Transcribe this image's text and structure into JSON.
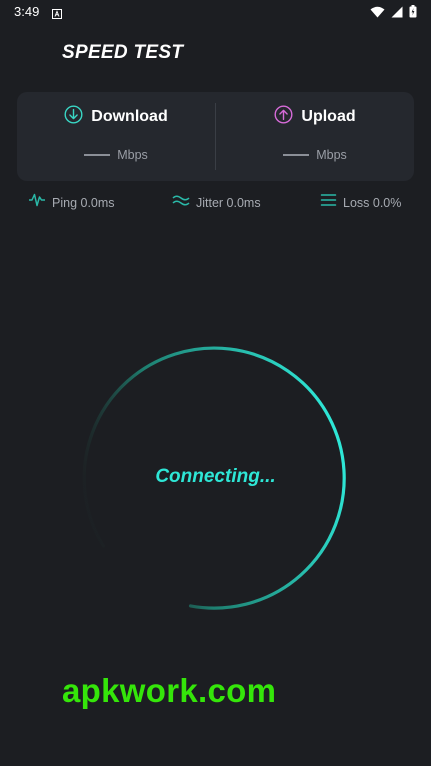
{
  "status_bar": {
    "time": "3:49",
    "notification_icon": "a-box-icon",
    "icons": [
      "wifi-icon",
      "signal-icon",
      "battery-icon"
    ]
  },
  "app": {
    "title": "SPEED TEST"
  },
  "speed_card": {
    "download": {
      "label": "Download",
      "value": "——",
      "unit": "Mbps",
      "icon": "download-arrow-icon",
      "color": "#39d6c4"
    },
    "upload": {
      "label": "Upload",
      "value": "——",
      "unit": "Mbps",
      "icon": "upload-arrow-icon",
      "color": "#d66bd8"
    }
  },
  "metrics": {
    "ping": {
      "text": "Ping 0.0ms",
      "icon": "ping-icon"
    },
    "jitter": {
      "text": "Jitter 0.0ms",
      "icon": "jitter-icon"
    },
    "loss": {
      "text": "Loss 0.0%",
      "icon": "loss-icon"
    }
  },
  "gauge": {
    "status": "Connecting...",
    "progress_arc_color_start": "#1f2b2a",
    "progress_arc_color_end": "#2ee6d6"
  },
  "watermark": {
    "text": "apkwork.com",
    "color": "#35e60a"
  },
  "colors": {
    "background": "#1c1e22",
    "card": "#25282e",
    "accent": "#2ee6d6"
  }
}
